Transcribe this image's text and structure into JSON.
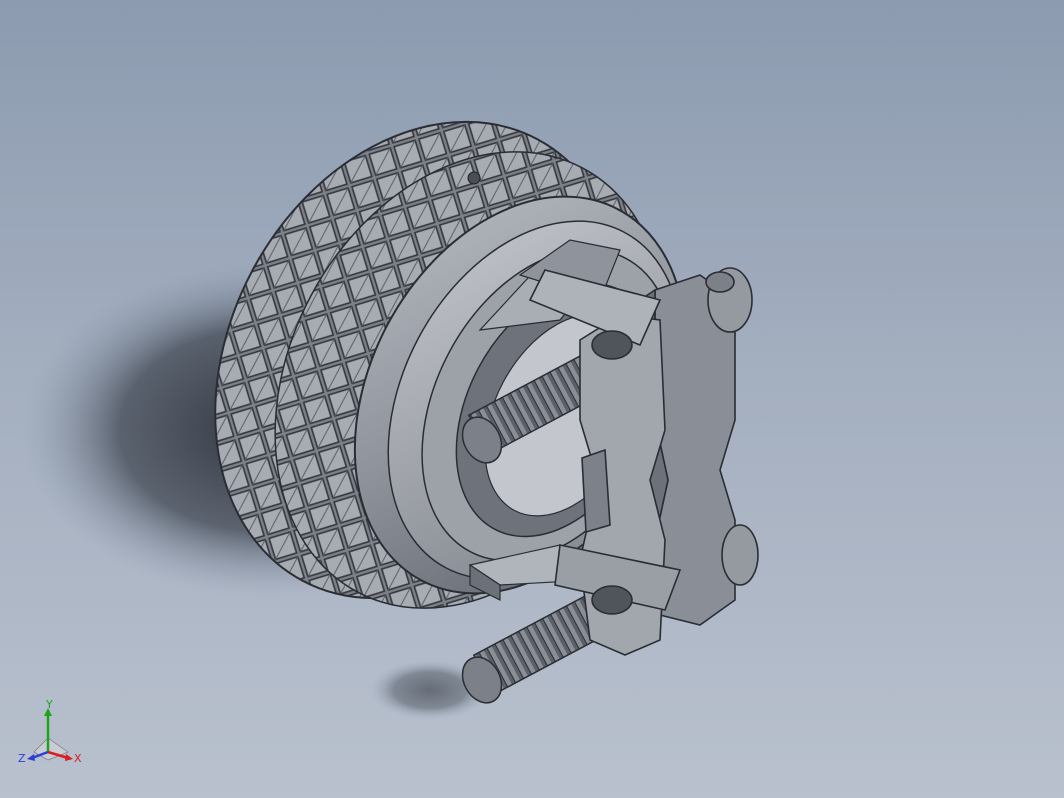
{
  "viewport": {
    "background_top": "#8c9bb0",
    "background_bottom": "#b9c1ce"
  },
  "model": {
    "body_color": "#8f939b",
    "edge_color": "#2a2d33"
  },
  "triad": {
    "x_label": "X",
    "y_label": "Y",
    "z_label": "Z",
    "x_color": "#d81e1e",
    "y_color": "#1fa31f",
    "z_color": "#2b3fd6"
  }
}
